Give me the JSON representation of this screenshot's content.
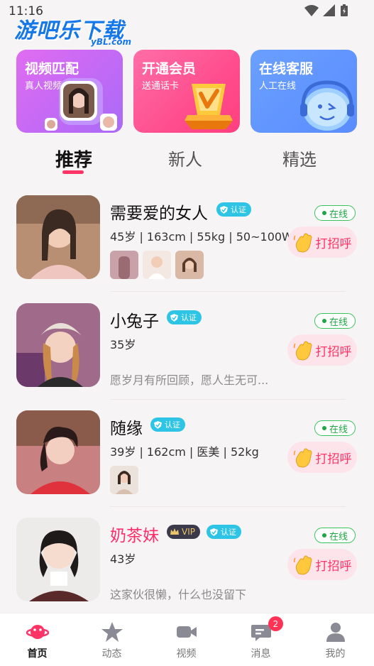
{
  "status_bar": {
    "time": "11:16"
  },
  "watermark": {
    "main": "游吧乐下载",
    "sub": "yBL.com"
  },
  "banners": [
    {
      "title": "视频匹配",
      "subtitle": "真人视频"
    },
    {
      "title": "开通会员",
      "subtitle": "送通话卡"
    },
    {
      "title": "在线客服",
      "subtitle": "人工在线"
    }
  ],
  "tabs": [
    {
      "label": "推荐",
      "active": true
    },
    {
      "label": "新人",
      "active": false
    },
    {
      "label": "精选",
      "active": false
    }
  ],
  "users": [
    {
      "name": "需要爱的女人",
      "verified": "认证",
      "info": "45岁 | 163cm | 55kg | 50~100W",
      "status": "在线",
      "greet": "打招呼",
      "photo_count": 3
    },
    {
      "name": "小兔子",
      "verified": "认证",
      "info": "35岁",
      "bio": "愿岁月有所回顾，愿人生无可...",
      "status": "在线",
      "greet": "打招呼"
    },
    {
      "name": "随缘",
      "verified": "认证",
      "info": "39岁 | 162cm | 医美 | 52kg",
      "status": "在线",
      "greet": "打招呼",
      "photo_count": 1
    },
    {
      "name": "奶茶妹",
      "vip": "VIP",
      "verified": "认证",
      "info": "43岁",
      "bio": "这家伙很懒，什么也没留下",
      "status": "在线",
      "greet": "打招呼"
    }
  ],
  "bottom_nav": [
    {
      "label": "首页",
      "icon": "planet-icon",
      "active": true
    },
    {
      "label": "动态",
      "icon": "star-icon"
    },
    {
      "label": "视频",
      "icon": "video-camera-icon"
    },
    {
      "label": "消息",
      "icon": "chat-bubble-icon",
      "badge": "2"
    },
    {
      "label": "我的",
      "icon": "person-icon"
    }
  ],
  "colors": {
    "accent": "#ff3366",
    "online": "#1fa644",
    "verified": "#2ec4e6"
  }
}
